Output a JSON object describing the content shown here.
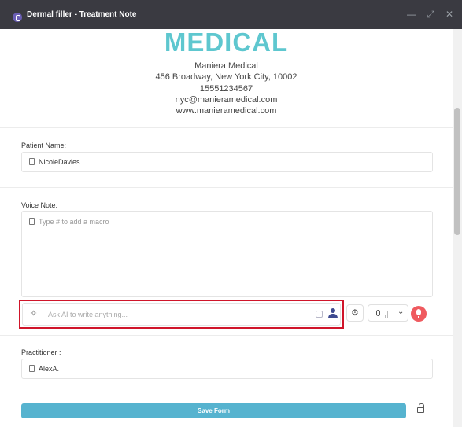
{
  "window": {
    "title": "Dermal filler - Treatment Note",
    "controls": [
      "minimize-icon",
      "maximize-icon",
      "close-icon"
    ]
  },
  "header": {
    "logo": "MEDICAL",
    "name": "Maniera Medical",
    "address": "456 Broadway, New York City, 10002",
    "phone": "15551234567",
    "email": "nyc@manieramedical.com",
    "website": "www.manieramedical.com"
  },
  "patient": {
    "label": "Patient Name:",
    "value": "NicoleDavies"
  },
  "voice_note": {
    "label": "Voice Note:",
    "placeholder": "Type # to add a macro",
    "ai_placeholder": "Ask AI to write anything..."
  },
  "practitioner": {
    "label": "Practitioner :",
    "value": "AlexA."
  },
  "actions": {
    "save_label": "Save Form"
  },
  "colors": {
    "titlebar": "#3a3a41",
    "logo": "#5ec7cf",
    "save": "#56b3cf",
    "highlight": "#d0152a",
    "record": "#ef5a5f"
  }
}
